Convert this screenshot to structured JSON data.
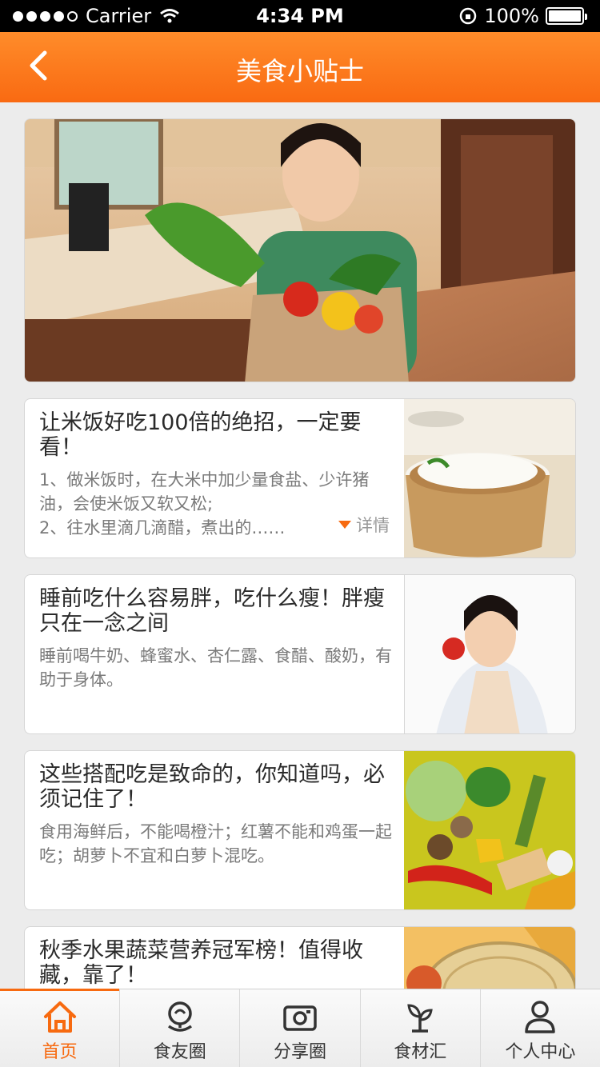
{
  "status_bar": {
    "carrier": "Carrier",
    "time": "4:34 PM",
    "battery": "100%"
  },
  "navbar": {
    "title": "美食小贴士"
  },
  "articles": [
    {
      "title": "让米饭好吃100倍的绝招，一定要看！",
      "desc": "1、做米饭时，在大米中加少量食盐、少许猪油，会使米饭又软又松;\n2、往水里滴几滴醋，煮出的……",
      "more": "详情"
    },
    {
      "title": "睡前吃什么容易胖，吃什么瘦！胖瘦只在一念之间",
      "desc": "睡前喝牛奶、蜂蜜水、杏仁露、食醋、酸奶，有助于身体。"
    },
    {
      "title": "这些搭配吃是致命的，你知道吗，必须记住了！",
      "desc": "食用海鲜后，不能喝橙汁；红薯不能和鸡蛋一起吃；胡萝卜不宜和白萝卜混吃。"
    },
    {
      "title": "秋季水果蔬菜营养冠军榜！值得收藏，靠了！"
    }
  ],
  "tabs": [
    {
      "label": "首页",
      "icon": "home-icon"
    },
    {
      "label": "食友圈",
      "icon": "chat-circle-icon"
    },
    {
      "label": "分享圈",
      "icon": "camera-icon"
    },
    {
      "label": "食材汇",
      "icon": "sprout-icon"
    },
    {
      "label": "个人中心",
      "icon": "user-icon"
    }
  ],
  "colors": {
    "accent": "#f76a10",
    "nav_top": "#ff8c2a"
  }
}
